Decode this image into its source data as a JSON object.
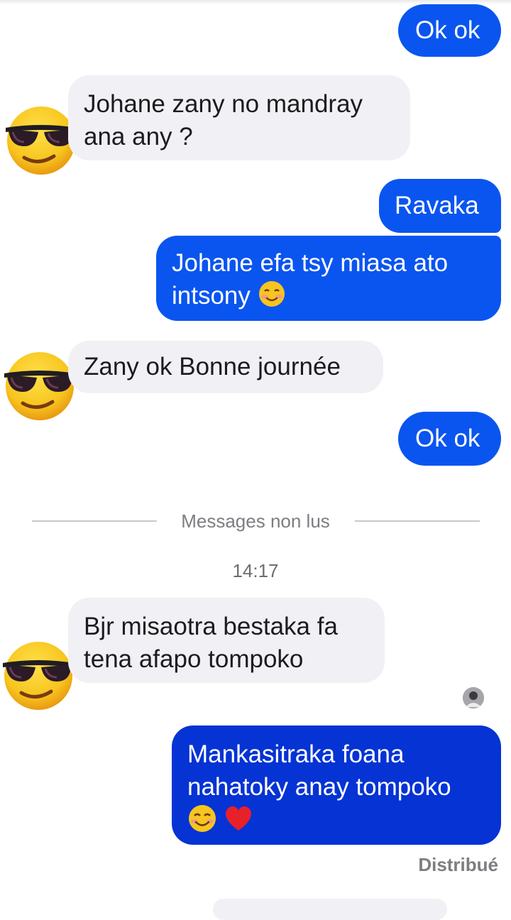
{
  "conversation": {
    "messages": [
      {
        "direction": "outgoing",
        "text": "Ok ok"
      },
      {
        "direction": "incoming",
        "text": "Johane zany no mandray ana any ?"
      },
      {
        "direction": "outgoing",
        "text": "Ravaka"
      },
      {
        "direction": "outgoing",
        "text": "Johane efa tsy miasa ato intsony",
        "emoji": "smiling-blush-emoji"
      },
      {
        "direction": "incoming",
        "text": "Zany ok Bonne journée"
      },
      {
        "direction": "outgoing",
        "text": "Ok ok"
      },
      {
        "direction": "incoming",
        "text": "Bjr misaotra bestaka fa tena afapo tompoko"
      },
      {
        "direction": "outgoing",
        "text": "Mankasitraka foana nahatoky anay tompoko",
        "emoji": [
          "smiling-emoji",
          "red-heart-emoji"
        ]
      }
    ],
    "unread_divider": "Messages non lus",
    "timestamp": "14:17",
    "delivery_status": "Distribué"
  },
  "sender_avatar_icon": "sunglasses-emoji",
  "colors": {
    "outgoing_bubble": "#0a55f0",
    "outgoing_bubble_latest": "#0533d4",
    "incoming_bubble": "#f1f0f5",
    "emoji_yellow": "#f7c51e"
  }
}
